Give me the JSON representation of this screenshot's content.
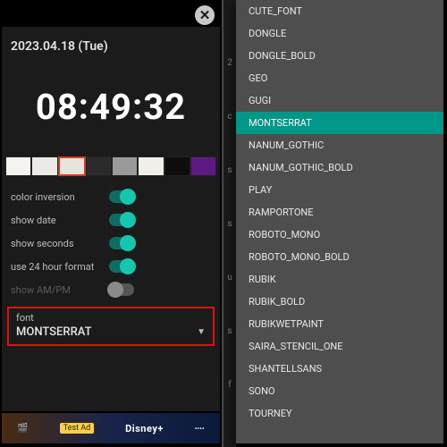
{
  "left": {
    "date": "2023.04.18 (Tue)",
    "time": "08:49:32",
    "swatches": [
      "#f4f3ef",
      "#eceae6",
      "#e8e5df",
      "#2b2b2b",
      "#9a9a9a",
      "#f1efe9",
      "#0d0d0d",
      "#5d1a82"
    ],
    "settings": {
      "color_inversion": {
        "label": "color inversion",
        "value": true
      },
      "show_date": {
        "label": "show date",
        "value": true
      },
      "show_seconds": {
        "label": "show seconds",
        "value": true
      },
      "use_24h": {
        "label": "use 24 hour format",
        "value": true
      },
      "show_ampm": {
        "label": "show AM/PM",
        "value": false
      }
    },
    "font_selector": {
      "label": "font",
      "value": "MONTSERRAT"
    },
    "ad": {
      "badge": "Test Ad",
      "brand": "Disney+"
    }
  },
  "right": {
    "options": [
      "CUTE_FONT",
      "DONGLE",
      "DONGLE_BOLD",
      "GEO",
      "GUGI",
      "MONTSERRAT",
      "NANUM_GOTHIC",
      "NANUM_GOTHIC_BOLD",
      "PLAY",
      "RAMPORTONE",
      "ROBOTO_MONO",
      "ROBOTO_MONO_BOLD",
      "RUBIK",
      "RUBIK_BOLD",
      "RUBIKWETPAINT",
      "SAIRA_STENCIL_ONE",
      "SHANTELLSANS",
      "SONO",
      "TOURNEY"
    ],
    "selected": "MONTSERRAT",
    "peek_chars": [
      "2",
      "c",
      "s",
      "s",
      "u",
      "s",
      "f"
    ]
  }
}
